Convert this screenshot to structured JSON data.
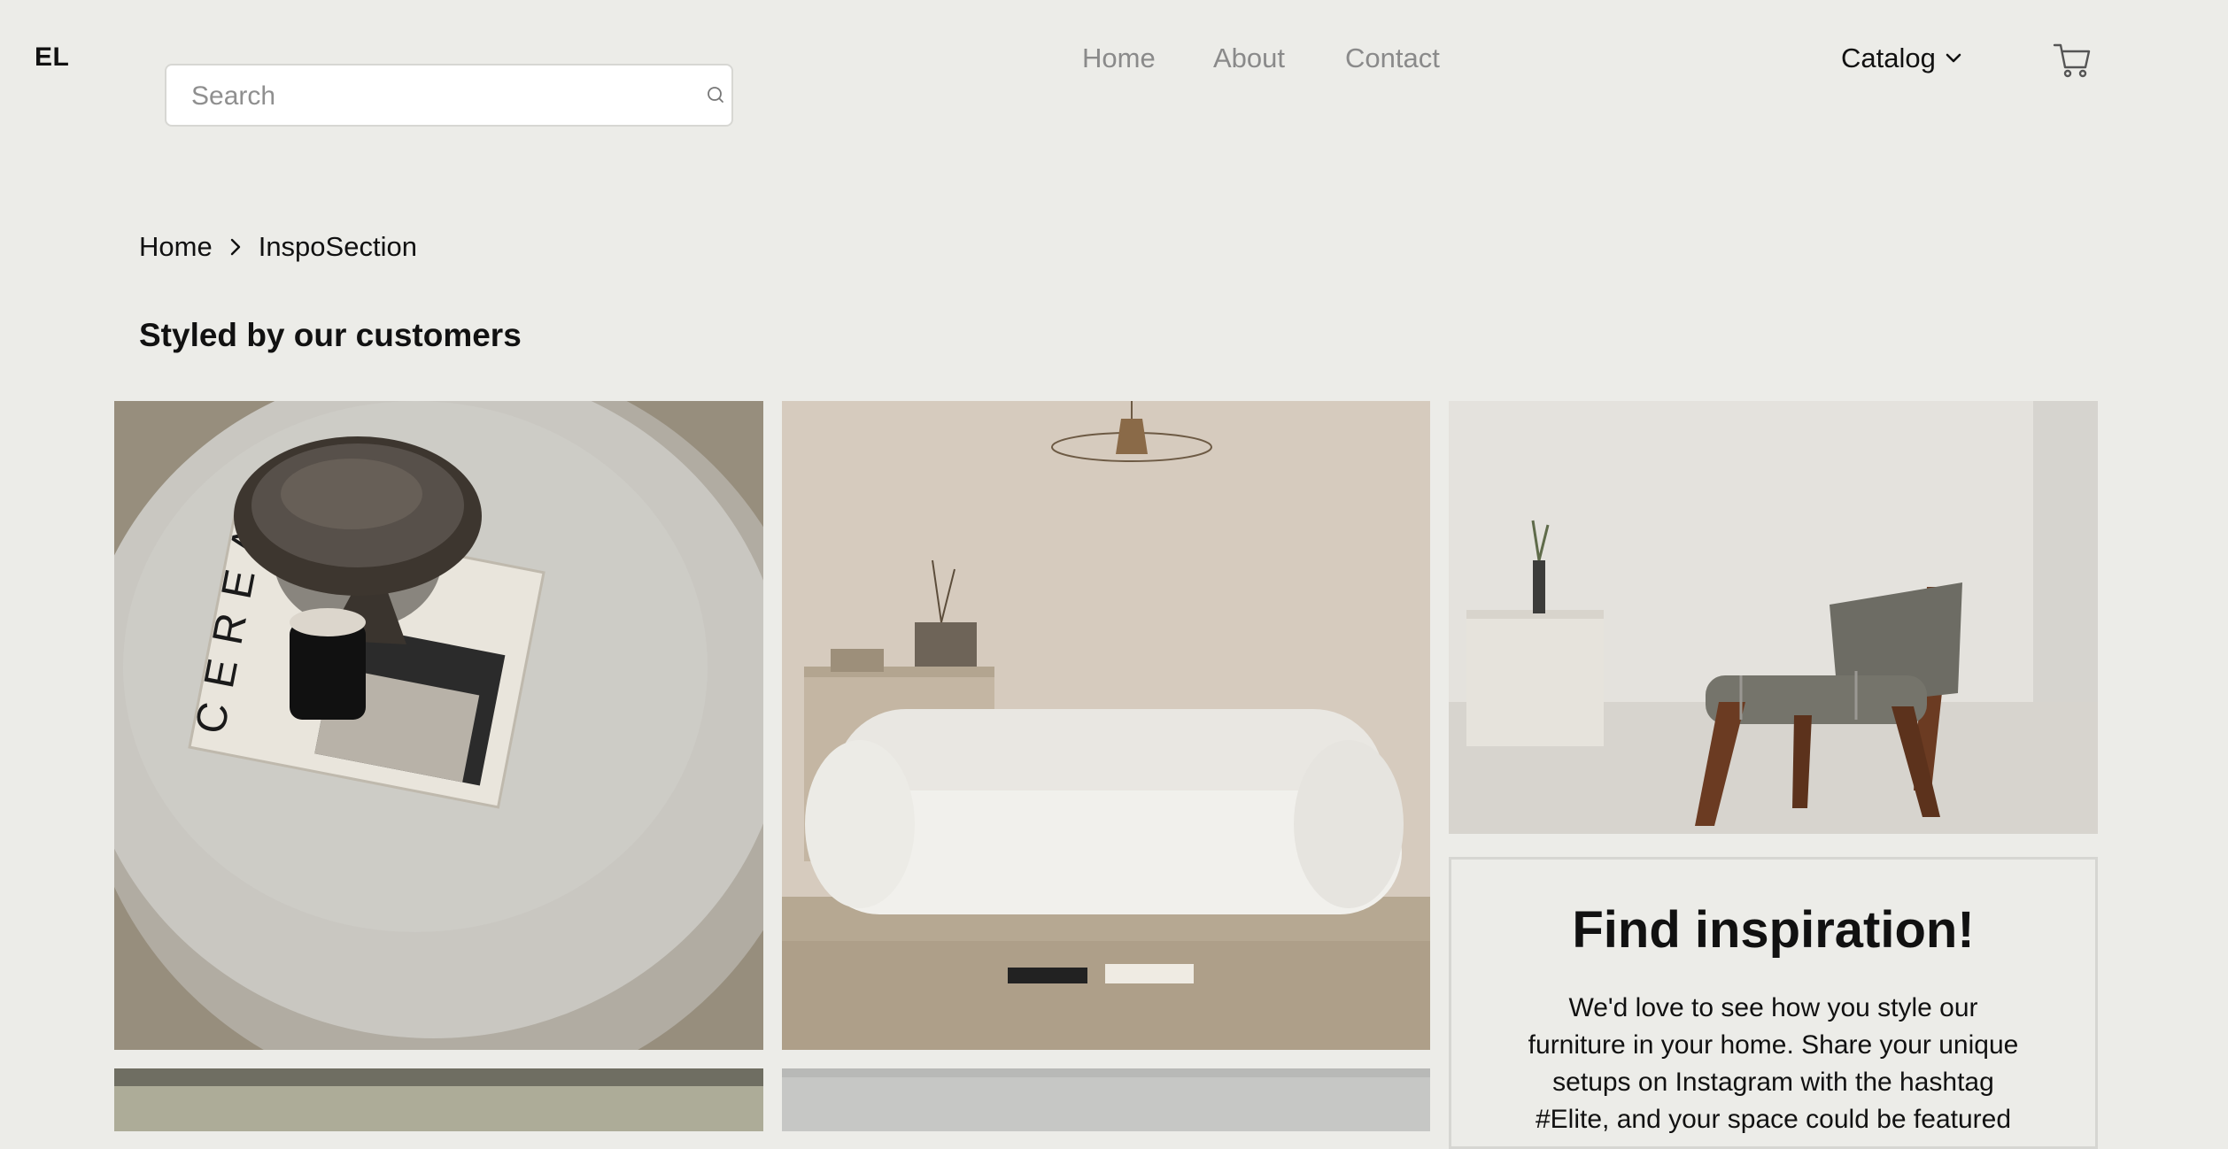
{
  "header": {
    "logo": "EL",
    "search": {
      "placeholder": "Search",
      "value": ""
    },
    "nav": {
      "home": "Home",
      "about": "About",
      "contact": "Contact"
    },
    "catalog": "Catalog",
    "icons": {
      "search": "search-icon",
      "cart": "cart-icon",
      "catalog": "chevron-down-icon"
    }
  },
  "breadcrumb": {
    "home": "Home",
    "current": "InspoSection"
  },
  "page": {
    "title": "Styled by our customers"
  },
  "gallery": {
    "images": [
      {
        "name": "table-with-bowl-and-magazine",
        "magazine_text": "CEREAL"
      },
      {
        "name": "living-room-sofa"
      },
      {
        "name": "wooden-armchair"
      },
      {
        "name": "gallery-image-4"
      },
      {
        "name": "gallery-image-5"
      }
    ]
  },
  "promo": {
    "heading": "Find inspiration!",
    "text": "We'd love to see how you style our furniture in your home. Share your unique setups on Instagram with the hashtag #Elite, and your space could be featured"
  },
  "colors": {
    "background": "#ecece8",
    "text": "#111111",
    "nav_muted": "#8a8a8a"
  }
}
